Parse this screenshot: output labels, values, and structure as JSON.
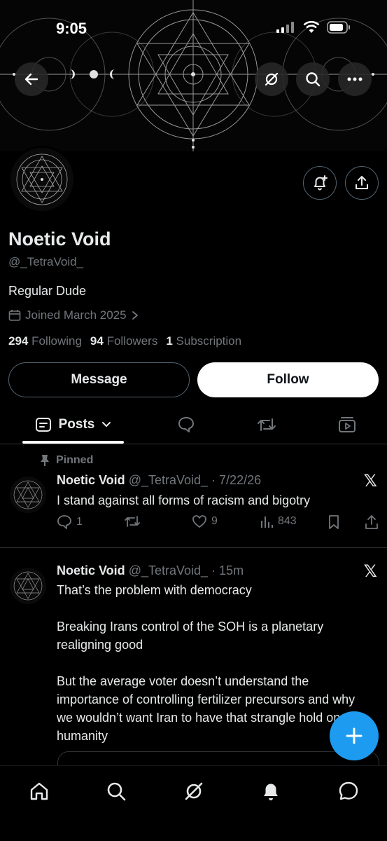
{
  "status_bar": {
    "time": "9:05"
  },
  "profile": {
    "name": "Noetic Void",
    "handle": "@_TetraVoid_",
    "bio": "Regular Dude",
    "joined": "Joined March 2025",
    "following_count": "294",
    "following_label": "Following",
    "followers_count": "94",
    "followers_label": "Followers",
    "subscription_count": "1",
    "subscription_label": "Subscription"
  },
  "buttons": {
    "message": "Message",
    "follow": "Follow"
  },
  "tabs": {
    "active": "Posts"
  },
  "posts": [
    {
      "pinned_label": "Pinned",
      "author": "Noetic Void",
      "handle_date": "@_TetraVoid_ · 7/22/26",
      "text": "I stand against all forms of racism and bigotry",
      "replies": "1",
      "likes": "9",
      "views": "843"
    },
    {
      "author": "Noetic Void",
      "handle_date": "@_TetraVoid_ · 15m",
      "paragraphs": [
        "That’s the problem with democracy",
        "Breaking Irans control of the SOH is a planetary realigning good",
        "But the average voter doesn’t understand the importance of controlling fertilizer precursors and why we wouldn’t want Iran to have that strangle hold on humanity"
      ]
    }
  ],
  "colors": {
    "accent": "#1d9bf0",
    "background": "#000000",
    "muted": "#71767b",
    "border": "#2f3336"
  }
}
